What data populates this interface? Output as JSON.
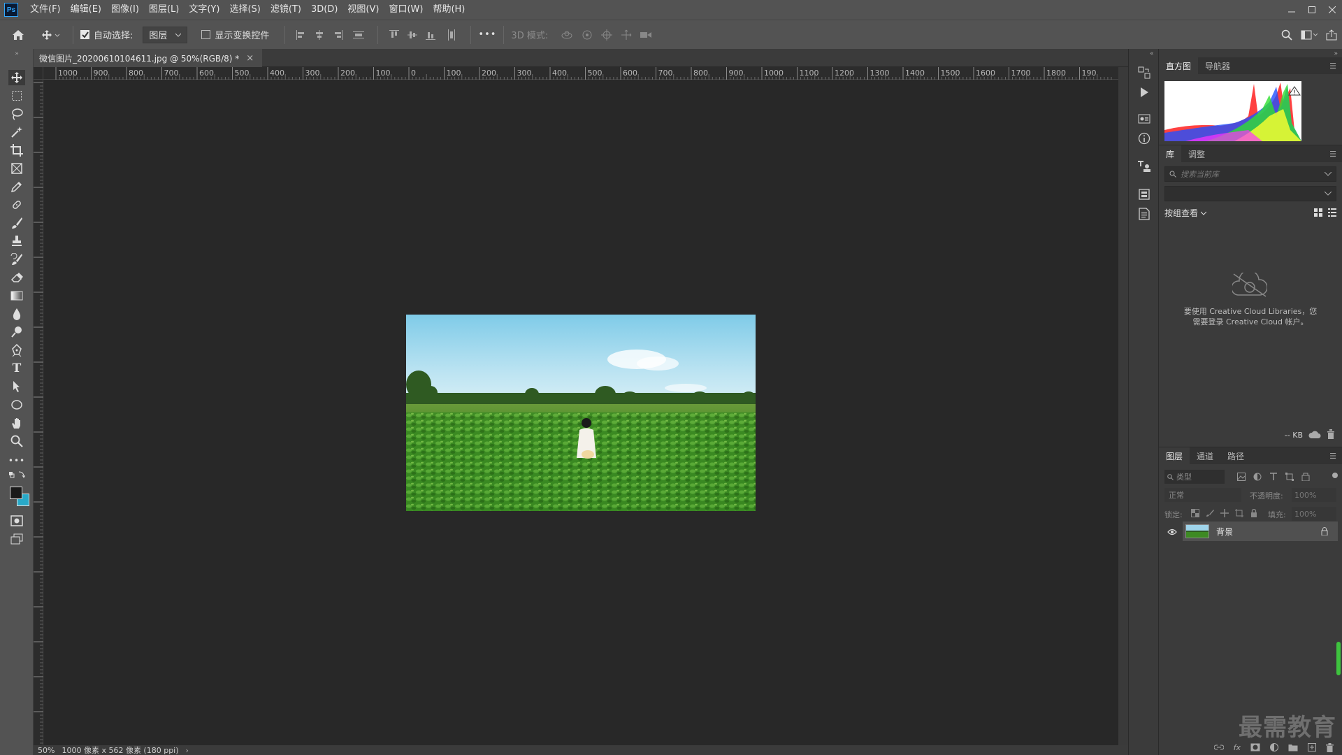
{
  "app": {
    "logo": "Ps"
  },
  "menu": [
    "文件(F)",
    "编辑(E)",
    "图像(I)",
    "图层(L)",
    "文字(Y)",
    "选择(S)",
    "滤镜(T)",
    "3D(D)",
    "视图(V)",
    "窗口(W)",
    "帮助(H)"
  ],
  "options": {
    "auto_select_label": "自动选择:",
    "auto_select_value": "图层",
    "show_transform_label": "显示变换控件",
    "mode_3d_label": "3D 模式:",
    "more": "•••"
  },
  "document": {
    "tab_title": "微信图片_20200610104611.jpg @ 50%(RGB/8) *",
    "close": "×"
  },
  "ruler": {
    "top_ticks": [
      "1000",
      "900",
      "800",
      "700",
      "600",
      "500",
      "400",
      "300",
      "200",
      "100",
      "0",
      "100",
      "200",
      "300",
      "400",
      "500",
      "600",
      "700",
      "800",
      "900",
      "1000",
      "1100",
      "1200",
      "1300",
      "1400",
      "1500",
      "1600",
      "1700",
      "1800",
      "190"
    ]
  },
  "status": {
    "zoom": "50%",
    "info": "1000 像素 x 562 像素 (180 ppi)"
  },
  "panels": {
    "histogram_tabs": [
      "直方图",
      "导航器"
    ],
    "library_tabs": [
      "库",
      "调整"
    ],
    "library_search_placeholder": "搜索当前库",
    "view_by_group": "按组查看",
    "cc_message_line1": "要使用 Creative Cloud Libraries，您",
    "cc_message_line2": "需要登录 Creative Cloud 帐户。",
    "library_size": "-- KB",
    "layers_tabs": [
      "图层",
      "通道",
      "路径"
    ],
    "filter_kind": "类型",
    "blend_mode": "正常",
    "opacity_label": "不透明度:",
    "opacity_value": "100%",
    "lock_label": "锁定:",
    "fill_label": "填充:",
    "fill_value": "100%",
    "layer_name": "背景"
  },
  "watermark": "最需教育",
  "colors": {
    "accent": "#31a8ff",
    "foreground": "#1a1a1a",
    "background": "#29a9c8"
  }
}
